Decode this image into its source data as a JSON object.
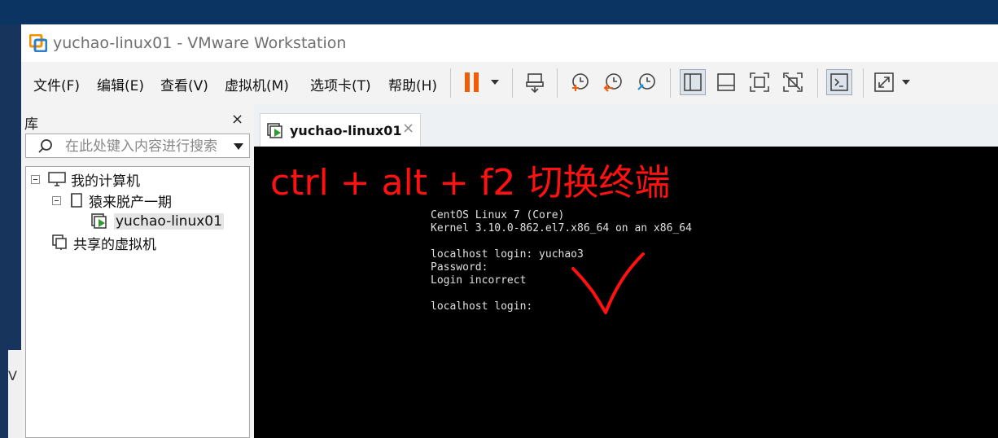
{
  "window": {
    "title": "yuchao-linux01 - VMware Workstation"
  },
  "menu": {
    "items": [
      "文件(F)",
      "编辑(E)",
      "查看(V)",
      "虚拟机(M)",
      "选项卡(T)",
      "帮助(H)"
    ]
  },
  "toolbar": {
    "icons": [
      "pause-icon",
      "send-ctrl-alt-del-icon",
      "snapshot-icon",
      "revert-snapshot-icon",
      "snapshot-manager-icon",
      "show-library-icon",
      "thumbnail-bar-icon",
      "full-screen-icon",
      "unity-icon",
      "console-view-icon",
      "stretch-guest-icon"
    ],
    "accent": "#f25c05"
  },
  "library": {
    "title": "库",
    "close_glyph": "×",
    "search_placeholder": "在此处键入内容进行搜索",
    "tree": [
      {
        "label": "我的计算机",
        "icon": "computer-icon"
      },
      {
        "label": "猿来脱产一期",
        "icon": "folder-icon"
      },
      {
        "label": "yuchao-linux01",
        "icon": "vm-running-icon",
        "selected": true
      },
      {
        "label": "共享的虚拟机",
        "icon": "shared-vms-icon"
      }
    ]
  },
  "tab": {
    "label": "yuchao-linux01",
    "close_glyph": "×"
  },
  "console": {
    "annotation": "ctrl + alt + f2 切换终端",
    "annotation_color": "#ff1111",
    "lines": [
      "CentOS Linux 7 (Core)",
      "Kernel 3.10.0-862.el7.x86_64 on an x86_64",
      "",
      "localhost login: yuchao3",
      "Password:",
      "Login incorrect",
      "",
      "localhost login:"
    ]
  },
  "background_peek": {
    "text": "V"
  }
}
